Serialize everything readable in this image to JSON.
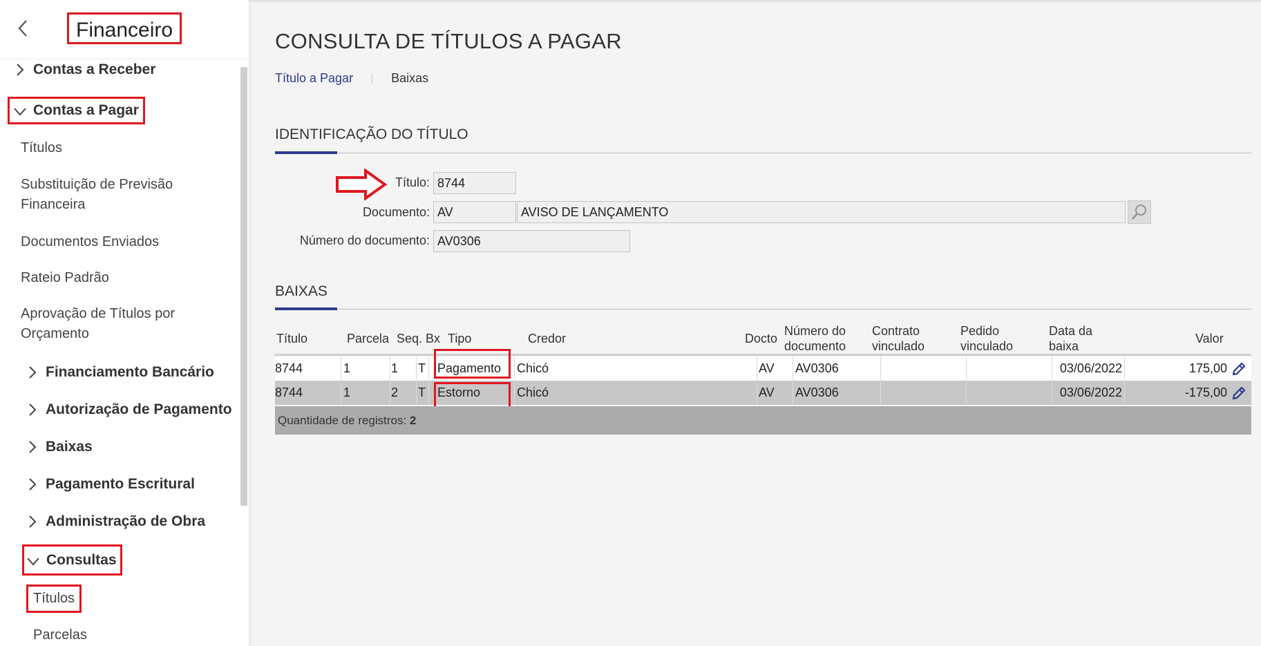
{
  "sidebar": {
    "title": "Financeiro",
    "items": [
      {
        "label": "Contas a Receber"
      },
      {
        "label": "Contas a Pagar"
      },
      {
        "label": "Títulos"
      },
      {
        "label": "Substituição de Previsão Financeira"
      },
      {
        "label": "Documentos Enviados"
      },
      {
        "label": "Rateio Padrão"
      },
      {
        "label": "Aprovação de Títulos por Orçamento"
      },
      {
        "label": "Financiamento Bancário"
      },
      {
        "label": "Autorização de Pagamento"
      },
      {
        "label": "Baixas"
      },
      {
        "label": "Pagamento Escritural"
      },
      {
        "label": "Administração de Obra"
      },
      {
        "label": "Consultas"
      },
      {
        "label": "Títulos"
      },
      {
        "label": "Parcelas"
      }
    ]
  },
  "page": {
    "title": "CONSULTA DE TÍTULOS A PAGAR",
    "tabs": [
      "Título a Pagar",
      "Baixas"
    ]
  },
  "identificacao": {
    "section_title": "IDENTIFICAÇÃO DO TÍTULO",
    "titulo_label": "Título:",
    "titulo_value": "8744",
    "documento_label": "Documento:",
    "documento_code": "AV",
    "documento_desc": "AVISO DE LANÇAMENTO",
    "numero_label": "Número do documento:",
    "numero_value": "AV0306"
  },
  "baixas": {
    "section_title": "BAIXAS",
    "columns": {
      "titulo": "Título",
      "parcela": "Parcela",
      "seq": "Seq.",
      "bx": "Bx",
      "tipo": "Tipo",
      "credor": "Credor",
      "docto": "Docto",
      "numero_l1": "Número do",
      "numero_l2": "documento",
      "contrato_l1": "Contrato",
      "contrato_l2": "vinculado",
      "pedido_l1": "Pedido",
      "pedido_l2": "vinculado",
      "data_l1": "Data da",
      "data_l2": "baixa",
      "valor": "Valor"
    },
    "rows": [
      {
        "titulo": "8744",
        "parcela": "1",
        "seq": "1",
        "bx": "T",
        "tipo": "Pagamento",
        "credor": "Chicó",
        "docto": "AV",
        "numero": "AV0306",
        "contrato": "",
        "pedido": "",
        "data": "03/06/2022",
        "valor": "175,00"
      },
      {
        "titulo": "8744",
        "parcela": "1",
        "seq": "2",
        "bx": "T",
        "tipo": "Estorno",
        "credor": "Chicó",
        "docto": "AV",
        "numero": "AV0306",
        "contrato": "",
        "pedido": "",
        "data": "03/06/2022",
        "valor": "-175,00"
      }
    ],
    "footer_label": "Quantidade de registros:",
    "footer_count": "2"
  },
  "colors": {
    "accent": "#2d3b8c",
    "highlight_red": "#e0161f",
    "selected_row": "#c7c7c7",
    "footer_bg": "#ababab"
  },
  "icons": [
    "chevron-left-icon",
    "chevron-right-icon",
    "chevron-down-icon",
    "search-icon",
    "edit-pencil-icon",
    "red-arrow-icon"
  ]
}
